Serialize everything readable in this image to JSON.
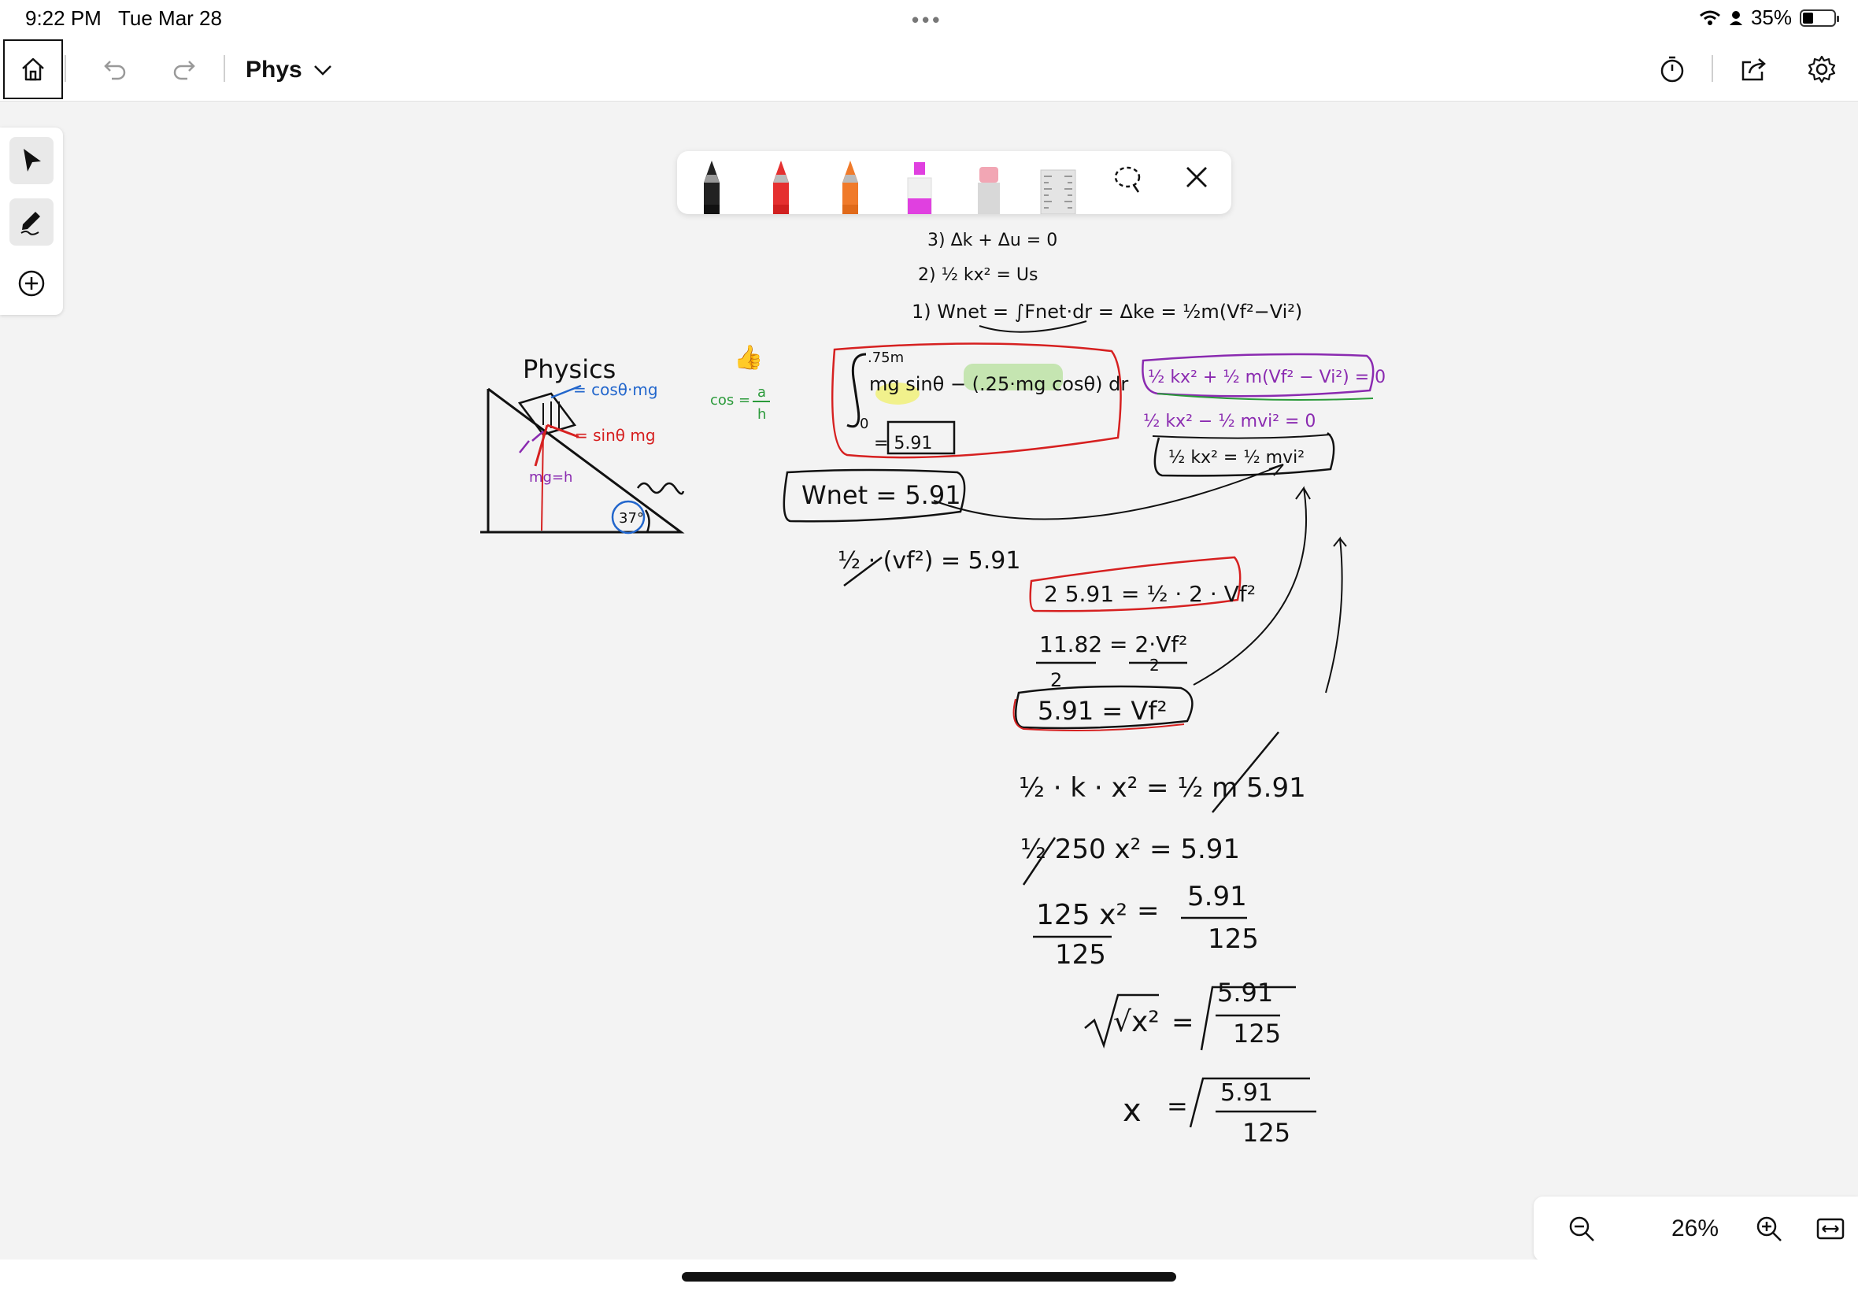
{
  "status_bar": {
    "time": "9:22 PM",
    "date": "Tue Mar 28",
    "battery": "35%",
    "battery_level": 0.35,
    "icons": [
      "wifi-icon",
      "person-icon",
      "battery-icon"
    ]
  },
  "toolbar": {
    "notebook_title": "Phys",
    "buttons": [
      "home-icon",
      "undo-icon",
      "redo-icon",
      "chevron-down-icon",
      "timer-icon",
      "share-icon",
      "settings-icon"
    ]
  },
  "rail": {
    "tools": [
      "select-arrow-icon",
      "pen-draw-icon",
      "add-icon"
    ],
    "selected": "pen-draw-icon"
  },
  "palette": {
    "tools": [
      {
        "name": "black-pen",
        "color": "#1a1a1a"
      },
      {
        "name": "red-pen",
        "color": "#e53030"
      },
      {
        "name": "orange-pen",
        "color": "#f07a2a"
      },
      {
        "name": "pink-highlighter",
        "color": "#e040e0"
      },
      {
        "name": "eraser",
        "color": "#f2a6b4"
      },
      {
        "name": "ruler",
        "color": "#c8c8c8"
      }
    ],
    "lasso": "lasso-icon",
    "close": "close-icon"
  },
  "ink": {
    "diagram_title": "Physics",
    "force_cos": "= cosθ·mg",
    "force_sin": "= sinθ mg",
    "weight": "mg=h",
    "angle": "37°",
    "cos_def_left": "cos =",
    "cos_def_num": "a",
    "cos_def_den": "h",
    "step3": "3)    Δk + Δu = 0",
    "step2": "2)   ½ kx² = Us",
    "step1": "1)  Wnet = ∫Fnet·dr = Δke = ½m(Vf²−Vi²)",
    "integral_upper": ".75m",
    "integral_lower": "0",
    "integrand": "mg sinθ − (.25·mg cosθ) dr",
    "integral_result": "= 5.91",
    "energy1": "½ kx² + ½ m(Vf² − Vi²) = 0",
    "energy2": "½ kx² − ½ mvi² = 0",
    "energy3": "½ kx² = ½ mvi²",
    "wnet": "Wnet = 5.91",
    "half_vf": "½ · (vf²) = 5.91",
    "eq1": "2  5.91 = ½ · 2 · Vf²",
    "eq2_num": "11.82  =  2·Vf²",
    "eq2_den_l": "2",
    "eq2_den_r": "2",
    "eq3": "5.91 = Vf²",
    "eq4": "½ · k · x²  =  ½ m  5.91",
    "eq5": "½ 250 x²   =   5.91",
    "eq6_l_num": "125 x²",
    "eq6_l_den": "125",
    "eq6_r_num": "5.91",
    "eq6_r_den": "125",
    "eq7_l": "√x²",
    "eq7_r_num": "5.91",
    "eq7_r_den": "125",
    "eq8_l": "x",
    "eq8_r_num": "5.91",
    "eq8_r_den": "125",
    "thumbs_up": "👍"
  },
  "zoom": {
    "level": "26%",
    "buttons": [
      "zoom-out-icon",
      "zoom-in-icon",
      "fit-width-icon"
    ]
  }
}
